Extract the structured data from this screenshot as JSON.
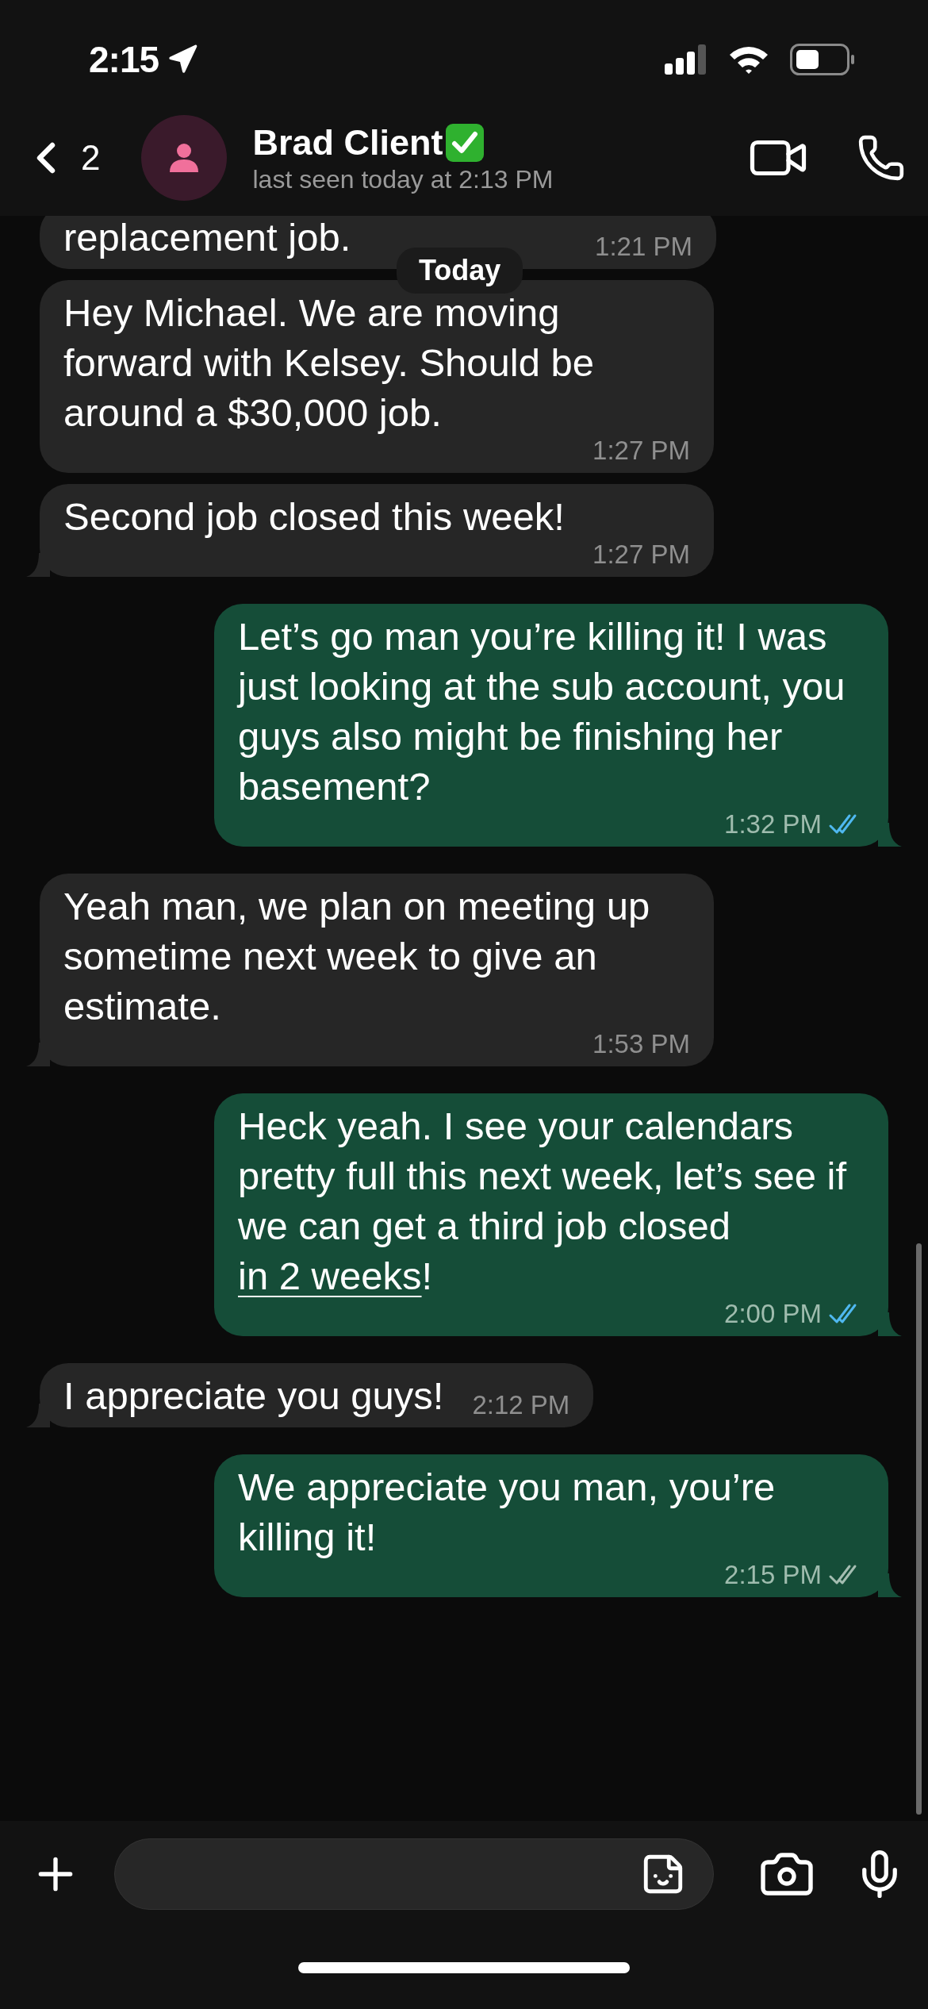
{
  "status_bar": {
    "time": "2:15"
  },
  "header": {
    "back_count": "2",
    "contact_name": "Brad Client",
    "verified": true,
    "last_seen": "last seen today at 2:13 PM"
  },
  "date_chip": "Today",
  "messages": [
    {
      "kind": "received",
      "parts": [
        {
          "text": "replacement job."
        }
      ],
      "time": "1:21 PM",
      "tail": false
    },
    {
      "kind": "received",
      "parts": [
        {
          "text": "Hey Michael. We are moving forward with Kelsey. Should be around a $30,000 job."
        }
      ],
      "time": "1:27 PM",
      "tail": false
    },
    {
      "kind": "received",
      "parts": [
        {
          "text": "Second job closed this week!"
        }
      ],
      "time": "1:27 PM",
      "tail": true
    },
    {
      "kind": "sent",
      "parts": [
        {
          "text": "Let’s go man you’re killing it! I was just looking at the sub account, you guys also might be finishing her basement?"
        }
      ],
      "time": "1:32 PM",
      "read": true,
      "tail": true
    },
    {
      "kind": "received",
      "parts": [
        {
          "text": "Yeah man, we plan on meeting up sometime next week to give an estimate."
        }
      ],
      "time": "1:53 PM",
      "tail": true
    },
    {
      "kind": "sent",
      "parts": [
        {
          "text": "Heck yeah. I see your calendars pretty full this next week, let’s see if we can get a third job closed "
        },
        {
          "text": "in 2 weeks",
          "kind": "link"
        },
        {
          "text": "!"
        }
      ],
      "time": "2:00 PM",
      "read": true,
      "tail": true
    },
    {
      "kind": "received",
      "parts": [
        {
          "text": "I appreciate you guys!"
        }
      ],
      "time": "2:12 PM",
      "tail": true
    },
    {
      "kind": "sent",
      "parts": [
        {
          "text": "We appreciate you man, you’re killing it!"
        }
      ],
      "time": "2:15 PM",
      "read": false,
      "tail": true
    }
  ]
}
